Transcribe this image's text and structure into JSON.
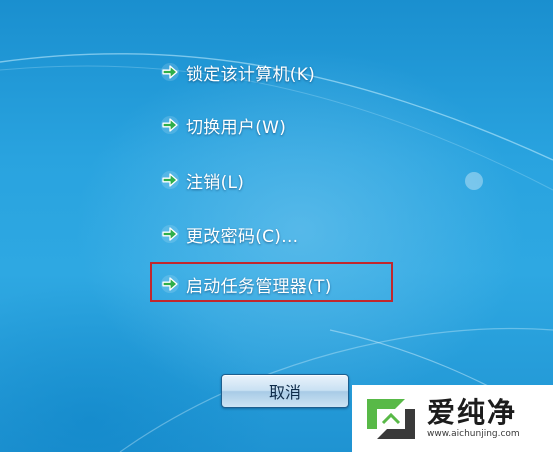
{
  "menu": {
    "items": [
      {
        "label": "锁定该计算机(K)",
        "icon": "green-arrow-icon"
      },
      {
        "label": "切换用户(W)",
        "icon": "green-arrow-icon"
      },
      {
        "label": "注销(L)",
        "icon": "green-arrow-icon"
      },
      {
        "label": "更改密码(C)...",
        "icon": "green-arrow-icon"
      },
      {
        "label": "启动任务管理器(T)",
        "icon": "green-arrow-icon",
        "highlighted": true
      }
    ]
  },
  "cancel_button": {
    "label": "取消"
  },
  "watermark": {
    "brand": "爱纯净",
    "url": "www.aichunjing.com"
  },
  "colors": {
    "background": "#2ea8e2",
    "arrow": "#2fae4a",
    "highlight": "#c1272d"
  }
}
